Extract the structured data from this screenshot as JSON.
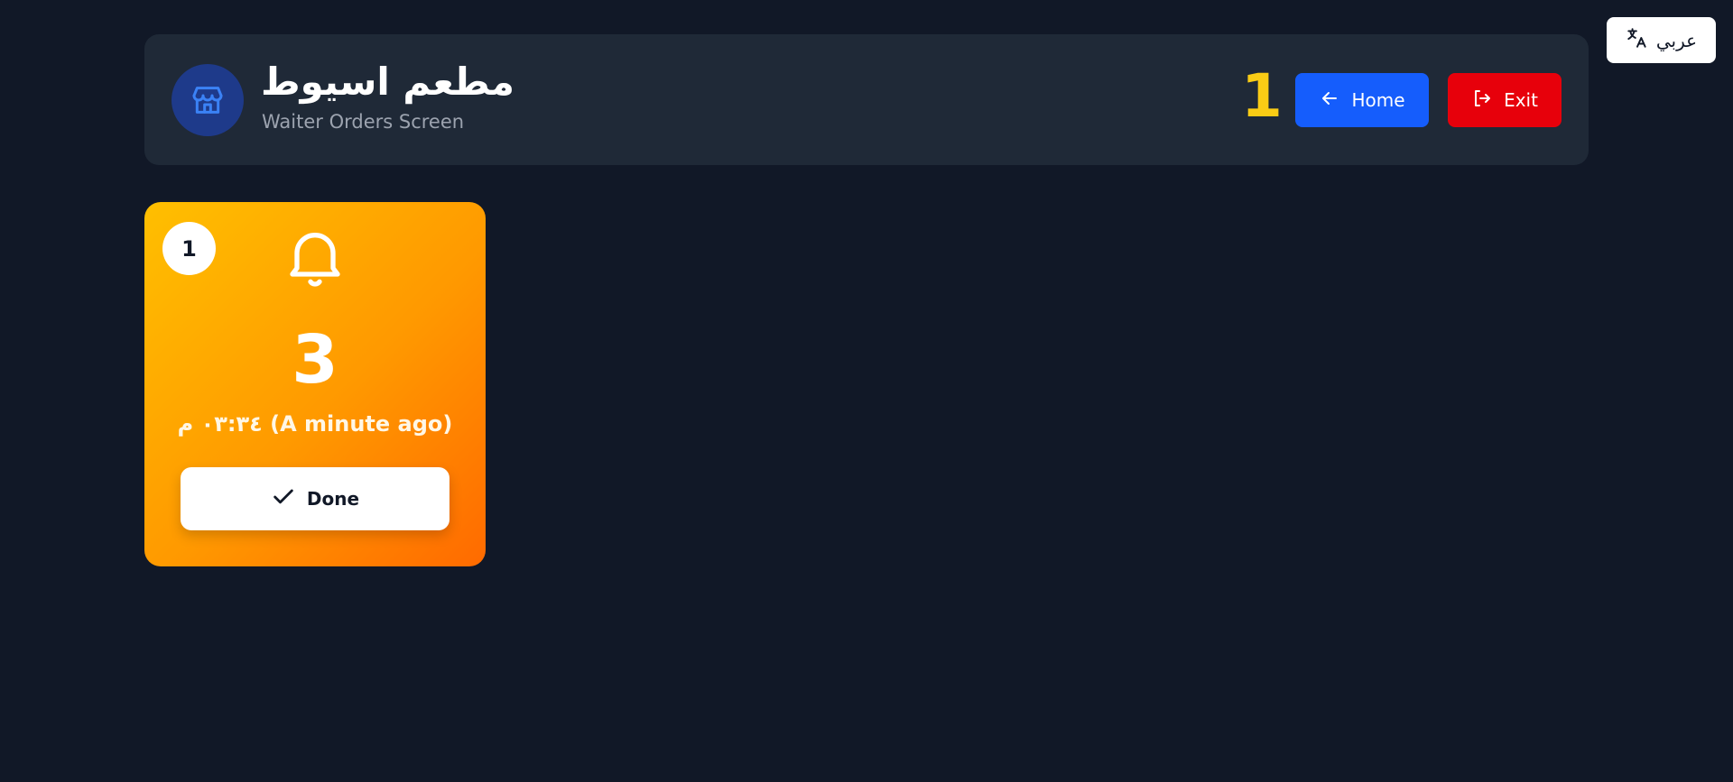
{
  "language_toggle": {
    "label": "عربي",
    "icon": "translate-icon"
  },
  "header": {
    "icon": "store-icon",
    "title": "مطعم اسيوط",
    "subtitle": "Waiter Orders Screen",
    "pending_count": "1",
    "home_button": {
      "label": "Home",
      "icon": "arrow-left-icon"
    },
    "exit_button": {
      "label": "Exit",
      "icon": "log-out-icon"
    }
  },
  "orders": [
    {
      "badge": "1",
      "icon": "bell-icon",
      "table_number": "3",
      "time": "٠٣:٣٤ م (A minute ago)",
      "done_button": {
        "label": "Done",
        "icon": "check-icon"
      }
    }
  ],
  "colors": {
    "background": "#111827",
    "header_bg": "#1f2937",
    "count": "#facc15",
    "home_button": "#155dfc",
    "exit_button": "#e7000b",
    "card_gradient_start": "#ffbf00",
    "card_gradient_end": "#ff6a00"
  }
}
